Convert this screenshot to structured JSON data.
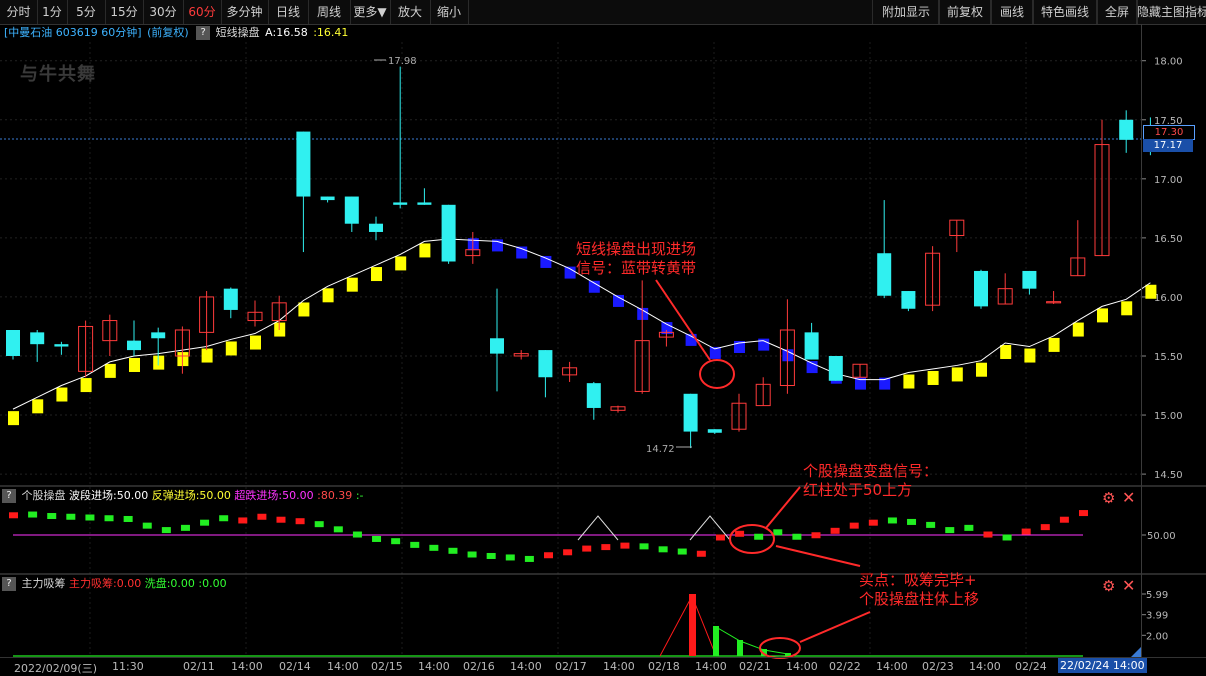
{
  "toolbar": {
    "left": [
      "分时",
      "1分",
      "5分",
      "15分",
      "30分",
      "60分",
      "多分钟",
      "日线",
      "周线",
      "更多▼",
      "放大",
      "缩小"
    ],
    "active": "60分",
    "right": [
      "附加显示",
      "前复权",
      "画线",
      "特色画线",
      "全屏",
      "隐藏主图指标"
    ]
  },
  "infobar": {
    "stock": "[中曼石油 603619 60分钟]",
    "adj": "(前复权)",
    "qmark": "?",
    "indicator": "短线操盘",
    "a_label": "A:16.58",
    "b_value": ":16.41"
  },
  "logo": "与牛共舞",
  "main_axis": {
    "ticks": [
      "18.00",
      "17.50",
      "17.00",
      "16.50",
      "16.00",
      "15.50",
      "15.00",
      "14.50"
    ],
    "tick_values": [
      18.0,
      17.5,
      17.0,
      16.5,
      16.0,
      15.5,
      15.0,
      14.5
    ],
    "price_tag_upper": "17.30",
    "price_tag_lower": "17.17",
    "high_label": "17.98",
    "low_label": "14.72"
  },
  "panel2": {
    "qmark": "?",
    "name": "个股操盘",
    "s1": "波段进场:50.00",
    "s2": "反弹进场:50.00",
    "s3": "超跌进场:50.00",
    "s4": ":80.39",
    "s5": ":-",
    "axis_label": "50.00"
  },
  "panel3": {
    "qmark": "?",
    "name": "主力吸筹",
    "s1": "主力吸筹:0.00",
    "s2": "洗盘:0.00",
    "s3": ":0.00",
    "axis": [
      "5.99",
      "3.99",
      "2.00"
    ]
  },
  "time_axis": {
    "labels": [
      "2022/02/09(三)",
      "11:30",
      "02/11",
      "14:00",
      "02/14",
      "14:00",
      "02/15",
      "14:00",
      "02/16",
      "14:00",
      "02/17",
      "14:00",
      "02/18",
      "14:00",
      "02/21",
      "14:00",
      "02/22",
      "14:00",
      "02/23",
      "14:00",
      "02/24"
    ],
    "cursor": "22/02/24 14:00"
  },
  "annotations": {
    "a1": [
      "短线操盘出现进场",
      "信号：蓝带转黄带"
    ],
    "a2": [
      "个股操盘变盘信号：",
      "红柱处于50上方"
    ],
    "a3": [
      "买点：吸筹完毕+",
      "个股操盘柱体上移"
    ]
  },
  "colors": {
    "up": "#ff3b3b",
    "down": "#30f0f0",
    "band_yellow": "#ffff00",
    "band_blue": "#1a1aff",
    "ma_line": "#ffffff",
    "osc_red": "#ff1a1a",
    "osc_green": "#22ee22",
    "baseline_magenta": "#ff33ff",
    "annotation": "#ff2a2a"
  },
  "chart_data": {
    "type": "candlestick",
    "candles": [
      [
        15.72,
        15.5,
        15.72,
        15.47
      ],
      [
        15.7,
        15.6,
        15.72,
        15.45
      ],
      [
        15.6,
        15.58,
        15.62,
        15.51
      ],
      [
        15.37,
        15.75,
        15.8,
        15.32
      ],
      [
        15.63,
        15.8,
        15.85,
        15.5
      ],
      [
        15.63,
        15.55,
        15.8,
        15.5
      ],
      [
        15.7,
        15.65,
        15.74,
        15.42
      ],
      [
        15.5,
        15.72,
        15.75,
        15.35
      ],
      [
        15.7,
        16.0,
        16.05,
        15.55
      ],
      [
        16.07,
        15.89,
        16.08,
        15.82
      ],
      [
        15.8,
        15.87,
        15.97,
        15.75
      ],
      [
        15.8,
        15.95,
        16.01,
        15.72
      ],
      [
        17.4,
        16.85,
        17.4,
        16.38
      ],
      [
        16.85,
        16.82,
        16.85,
        16.8
      ],
      [
        16.85,
        16.62,
        16.85,
        16.55
      ],
      [
        16.62,
        16.55,
        16.68,
        16.48
      ],
      [
        16.8,
        16.78,
        17.95,
        16.75
      ],
      [
        16.8,
        16.78,
        16.92,
        16.78
      ],
      [
        16.78,
        16.3,
        16.78,
        16.28
      ],
      [
        16.35,
        16.4,
        16.55,
        16.28
      ],
      [
        15.65,
        15.52,
        16.07,
        15.2
      ],
      [
        15.5,
        15.52,
        15.55,
        15.47
      ],
      [
        15.55,
        15.32,
        15.55,
        15.15
      ],
      [
        15.34,
        15.4,
        15.45,
        15.28
      ],
      [
        15.27,
        15.06,
        15.28,
        14.96
      ],
      [
        15.04,
        15.07,
        15.08,
        15.02
      ],
      [
        15.2,
        15.63,
        16.14,
        15.18
      ],
      [
        15.66,
        15.7,
        15.72,
        15.58
      ],
      [
        15.18,
        14.86,
        15.18,
        14.72
      ],
      [
        14.88,
        14.85,
        14.88,
        14.84
      ],
      [
        14.88,
        15.1,
        15.18,
        14.86
      ],
      [
        15.08,
        15.26,
        15.32,
        15.08
      ],
      [
        15.25,
        15.72,
        15.98,
        15.18
      ],
      [
        15.7,
        15.47,
        15.78,
        15.47
      ],
      [
        15.5,
        15.29,
        15.5,
        15.29
      ],
      [
        15.32,
        15.43,
        15.43,
        15.32
      ],
      [
        16.37,
        16.01,
        16.82,
        15.99
      ],
      [
        16.05,
        15.9,
        16.05,
        15.88
      ],
      [
        15.93,
        16.37,
        16.43,
        15.88
      ],
      [
        16.52,
        16.65,
        16.65,
        16.38
      ],
      [
        16.22,
        15.92,
        16.23,
        15.9
      ],
      [
        15.94,
        16.07,
        16.2,
        15.94
      ],
      [
        16.22,
        16.07,
        16.22,
        16.02
      ],
      [
        15.95,
        15.96,
        16.05,
        15.94
      ],
      [
        16.18,
        16.33,
        16.65,
        16.18
      ],
      [
        16.35,
        17.29,
        17.5,
        16.35
      ],
      [
        17.5,
        17.33,
        17.58,
        17.22
      ],
      [
        17.3,
        17.25,
        17.52,
        17.2
      ]
    ],
    "band": [
      15.05,
      15.15,
      15.25,
      15.33,
      15.45,
      15.5,
      15.52,
      15.55,
      15.58,
      15.64,
      15.69,
      15.8,
      15.97,
      16.09,
      16.18,
      16.27,
      16.36,
      16.47,
      16.49,
      16.48,
      16.47,
      16.41,
      16.33,
      16.24,
      16.12,
      16.0,
      15.89,
      15.77,
      15.67,
      15.56,
      15.61,
      15.63,
      15.54,
      15.44,
      15.35,
      15.3,
      15.3,
      15.36,
      15.39,
      15.42,
      15.46,
      15.61,
      15.58,
      15.67,
      15.8,
      15.92,
      15.98,
      16.12
    ],
    "band_is_blue": [
      false,
      false,
      false,
      false,
      false,
      false,
      false,
      false,
      false,
      false,
      false,
      false,
      false,
      false,
      false,
      false,
      false,
      false,
      false,
      true,
      true,
      true,
      true,
      true,
      true,
      true,
      true,
      true,
      true,
      true,
      true,
      true,
      true,
      true,
      true,
      true,
      true,
      false,
      false,
      false,
      false,
      false,
      false,
      false,
      false,
      false,
      false,
      false
    ],
    "osc": [
      78,
      79,
      77,
      76,
      75,
      74,
      73,
      64,
      58,
      61,
      68,
      74,
      71,
      76,
      72,
      70,
      66,
      59,
      52,
      46,
      43,
      38,
      34,
      30,
      25,
      23,
      21,
      19,
      24,
      28,
      33,
      35,
      37,
      36,
      32,
      29,
      26,
      48,
      53,
      49,
      55,
      49,
      51,
      57,
      64,
      68,
      71,
      69,
      65,
      58,
      61,
      52,
      48,
      56,
      62,
      72,
      81
    ],
    "osc_is_red": [
      true,
      false,
      false,
      false,
      false,
      false,
      false,
      false,
      false,
      false,
      false,
      false,
      true,
      true,
      true,
      true,
      false,
      false,
      false,
      false,
      false,
      false,
      false,
      false,
      false,
      false,
      false,
      false,
      true,
      true,
      true,
      true,
      true,
      false,
      false,
      false,
      true,
      true,
      true,
      false,
      false,
      false,
      true,
      true,
      true,
      true,
      false,
      false,
      false,
      false,
      false,
      true,
      false,
      true,
      true,
      true,
      true
    ],
    "absorb_peak": 5.99,
    "y_range": [
      14.45,
      18.15
    ]
  }
}
